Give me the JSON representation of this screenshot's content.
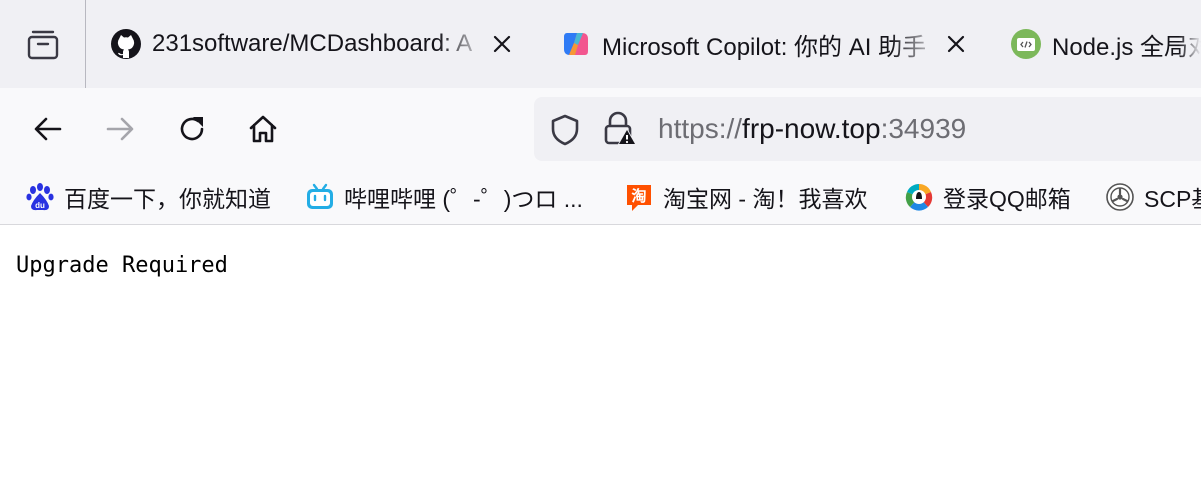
{
  "tabs": [
    {
      "title": "231software/MCDashboard: A",
      "favicon": "github-icon"
    },
    {
      "title": "Microsoft Copilot: 你的 AI 助手",
      "favicon": "copilot-icon"
    },
    {
      "title": "Node.js 全局对",
      "favicon": "nodejs-docs-icon"
    }
  ],
  "navbar": {
    "url": {
      "scheme": "https://",
      "host": "frp-now.top",
      "port": ":34939"
    }
  },
  "bookmarks": [
    {
      "label": "百度一下，你就知道",
      "icon": "baidu-icon"
    },
    {
      "label": "哔哩哔哩 (゜-゜)つロ ...",
      "icon": "bilibili-icon"
    },
    {
      "label": "淘宝网 - 淘！我喜欢",
      "icon": "taobao-icon"
    },
    {
      "label": "登录QQ邮箱",
      "icon": "qq-mail-icon"
    },
    {
      "label": "SCP基",
      "icon": "scp-icon"
    }
  ],
  "content": {
    "text": "Upgrade Required"
  },
  "colors": {
    "tabstrip_bg": "#f0f0f4",
    "toolbar_bg": "#f9f9fb",
    "urlbar_bg": "#f0f0f4",
    "text": "#15141a",
    "url_dim": "#6d6d73",
    "warning_red": "#e22850"
  }
}
